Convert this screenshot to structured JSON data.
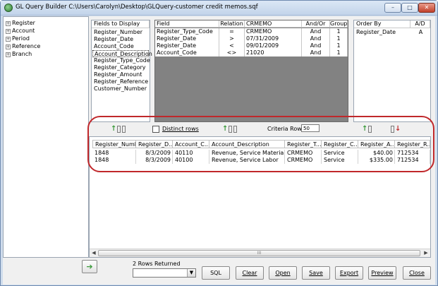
{
  "window": {
    "title": "GL Query Builder C:\\Users\\Carolyn\\Desktop\\GLQuery-customer credit memos.sqf",
    "min_glyph": "–",
    "max_glyph": "□",
    "close_glyph": "✕"
  },
  "tree": {
    "expander_glyph": "+",
    "items": [
      "Register",
      "Account",
      "Period",
      "Reference",
      "Branch"
    ]
  },
  "fields_to_display": {
    "header": "Fields to Display",
    "items": [
      "Register_Number",
      "Register_Date",
      "Account_Code",
      "Account_Description",
      "Register_Type_Code",
      "Register_Category",
      "Register_Amount",
      "Register_Reference",
      "Customer_Number"
    ],
    "selected_index": 3
  },
  "criteria": {
    "headers": [
      "Field",
      "Relation",
      "CRMEMO",
      "And/Or",
      "Group"
    ],
    "rows": [
      [
        "Register_Type_Code",
        "=",
        "CRMEMO",
        "And",
        "1"
      ],
      [
        "Register_Date",
        ">",
        "07/31/2009",
        "And",
        "1"
      ],
      [
        "Register_Date",
        "<",
        "09/01/2009",
        "And",
        "1"
      ],
      [
        "Account_Code",
        "<>",
        "21020",
        "And",
        "1"
      ]
    ]
  },
  "order_by": {
    "headers": [
      "Order By",
      "A/D"
    ],
    "rows": [
      [
        "Register_Date",
        "A"
      ]
    ]
  },
  "options": {
    "distinct_rows_label": "Distinct rows",
    "criteria_rows_label": "Criteria Rows:",
    "criteria_rows_value": "50"
  },
  "results": {
    "headers": [
      "Register_Number",
      "Register_D...",
      "Account_C...",
      "Account_Description",
      "Register_T...",
      "Register_C...",
      "Register_A...",
      "Register_R..."
    ],
    "rows": [
      [
        "1848",
        "8/3/2009",
        "40110",
        "Revenue, Service Materials",
        "CRMEMO",
        "Service",
        "$40.00",
        "712534"
      ],
      [
        "1848",
        "8/3/2009",
        "40100",
        "Revenue, Service Labor",
        "CRMEMO",
        "Service",
        "$335.00",
        "712534"
      ]
    ],
    "scroll_left_glyph": "◀",
    "scroll_right_glyph": "▶",
    "thumb_grip": "III"
  },
  "bottom": {
    "run_glyph": "➔",
    "rows_returned": "2 Rows Returned",
    "combo_value": "",
    "combo_glyph": "▼",
    "buttons": {
      "sql": "SQL",
      "clear": "Clear",
      "open": "Open",
      "save": "Save",
      "export": "Export",
      "preview": "Preview",
      "close": "Close"
    }
  },
  "colors": {
    "highlight_annotation": "#c0282b",
    "criteria_background": "#828282",
    "arrow_green": "#3a9a3a"
  },
  "icons": {
    "title": "app-globe-icon",
    "movers": "move-column-icon",
    "run": "run-query-arrow-icon"
  }
}
